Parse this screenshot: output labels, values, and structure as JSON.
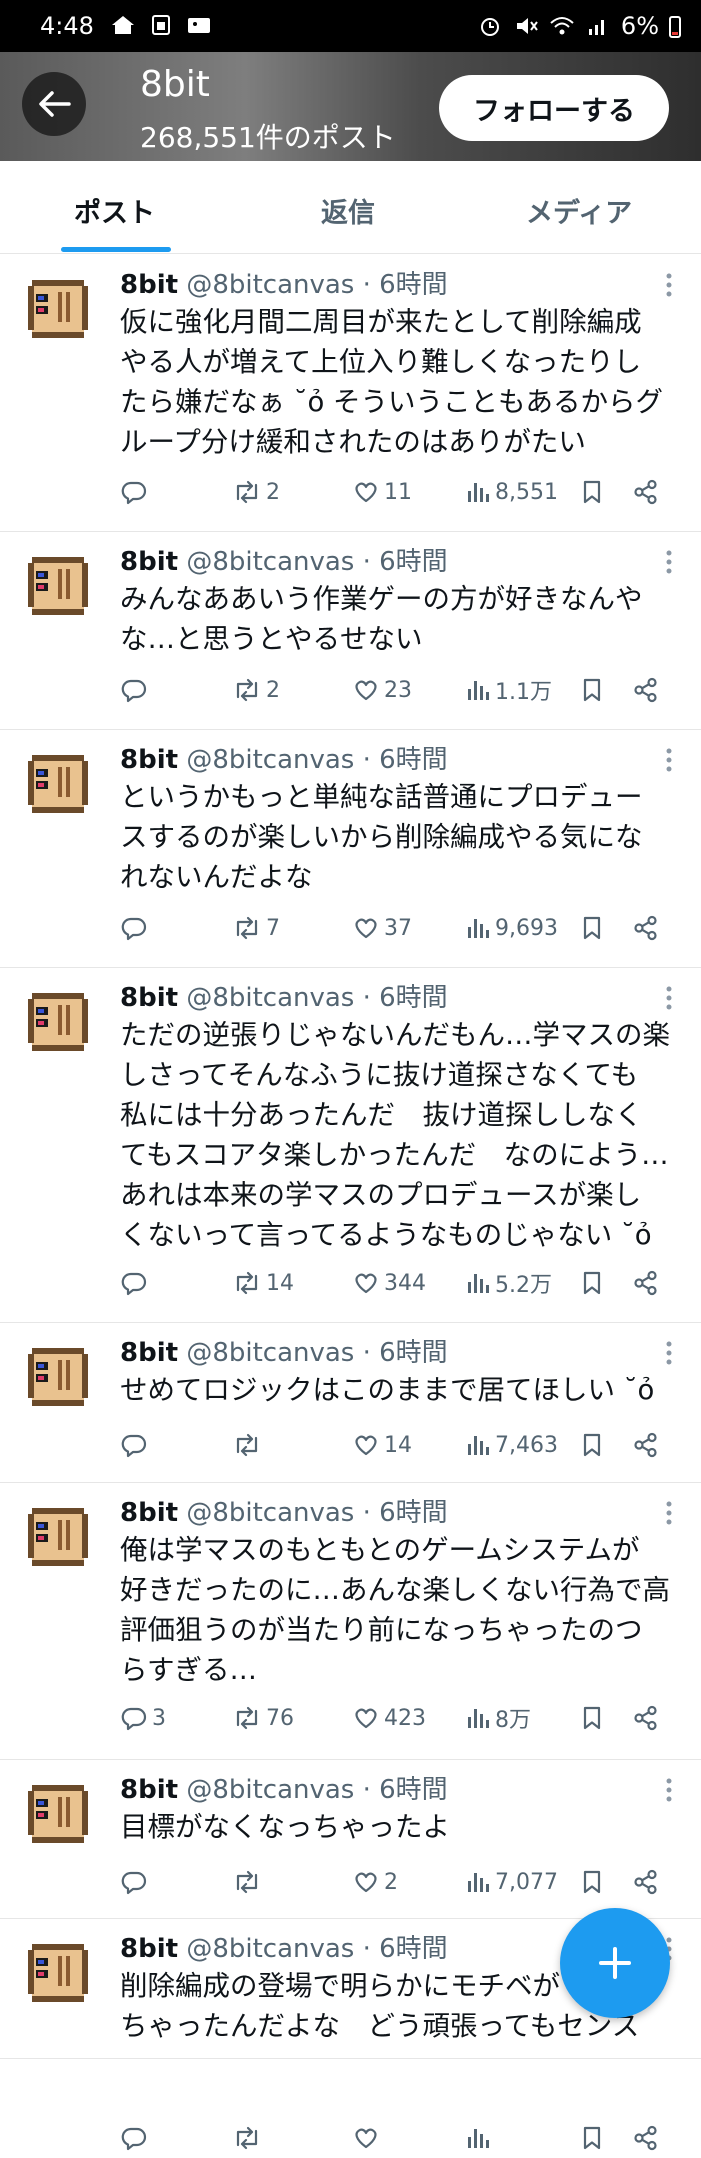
{
  "status_bar": {
    "time": "4:48",
    "battery": "6%"
  },
  "header": {
    "name": "8bit",
    "post_count": "268,551件のポスト",
    "follow_label": "フォローする"
  },
  "tabs": [
    {
      "label": "ポスト",
      "active": true
    },
    {
      "label": "返信",
      "active": false
    },
    {
      "label": "メディア",
      "active": false
    }
  ],
  "posts": [
    {
      "name": "8bit",
      "meta": "@8bitcanvas · 6時間",
      "lines": [
        "仮に強化月間二周目が来たとして削除編成",
        "やる人が増えて上位入り難しくなったりし",
        "たら嫌だなぁ ˘ỏ そういうこともあるからグ",
        "ループ分け緩和されたのはありがたい"
      ],
      "replies": "",
      "reposts": "2",
      "likes": "11",
      "views": "8,551"
    },
    {
      "name": "8bit",
      "meta": "@8bitcanvas · 6時間",
      "lines": [
        "みんなああいう作業ゲーの方が好きなんや",
        "な…と思うとやるせない"
      ],
      "replies": "",
      "reposts": "2",
      "likes": "23",
      "views": "1.1万"
    },
    {
      "name": "8bit",
      "meta": "@8bitcanvas · 6時間",
      "lines": [
        "というかもっと単純な話普通にプロデュー",
        "スするのが楽しいから削除編成やる気にな",
        "れないんだよな"
      ],
      "replies": "",
      "reposts": "7",
      "likes": "37",
      "views": "9,693"
    },
    {
      "name": "8bit",
      "meta": "@8bitcanvas · 6時間",
      "lines": [
        "ただの逆張りじゃないんだもん…学マスの楽",
        "しさってそんなふうに抜け道探さなくても",
        "私には十分あったんだ　抜け道探ししなく",
        "てもスコアタ楽しかったんだ　なのによう…",
        "あれは本来の学マスのプロデュースが楽し",
        "くないって言ってるようなものじゃない ˘ỏ"
      ],
      "replies": "",
      "reposts": "14",
      "likes": "344",
      "views": "5.2万"
    },
    {
      "name": "8bit",
      "meta": "@8bitcanvas · 6時間",
      "lines": [
        "せめてロジックはこのままで居てほしい ˘ỏ"
      ],
      "replies": "",
      "reposts": "",
      "likes": "14",
      "views": "7,463"
    },
    {
      "name": "8bit",
      "meta": "@8bitcanvas · 6時間",
      "lines": [
        "俺は学マスのもともとのゲームシステムが",
        "好きだったのに…あんな楽しくない行為で高",
        "評価狙うのが当たり前になっちゃったのつ",
        "らすぎる…"
      ],
      "replies": "3",
      "reposts": "76",
      "likes": "423",
      "views": "8万"
    },
    {
      "name": "8bit",
      "meta": "@8bitcanvas · 6時間",
      "lines": [
        "目標がなくなっちゃったよ"
      ],
      "replies": "",
      "reposts": "",
      "likes": "2",
      "views": "7,077"
    },
    {
      "name": "8bit",
      "meta": "@8bitcanvas · 6時間",
      "lines": [
        "削除編成の登場で明らかにモチベが",
        "ちゃったんだよな　どう頑張ってもセンス"
      ],
      "replies": "",
      "reposts": "",
      "likes": "",
      "views": ""
    }
  ],
  "colors": {
    "accent": "#1d9bf0",
    "secondary_text": "#536471"
  },
  "icons": [
    "back-arrow-icon",
    "reply-icon",
    "repost-icon",
    "like-icon",
    "views-icon",
    "bookmark-icon",
    "share-icon",
    "more-icon",
    "compose-plus-icon"
  ]
}
